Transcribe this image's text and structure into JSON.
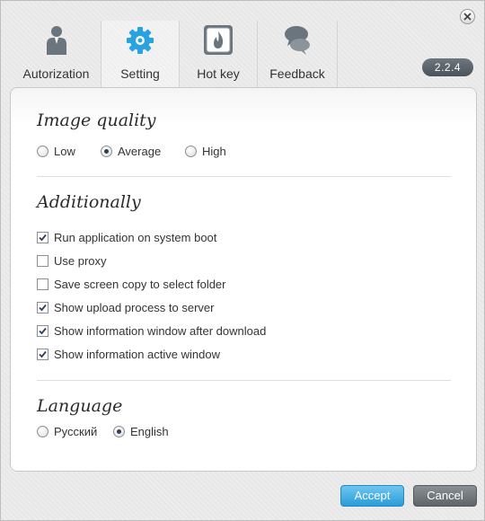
{
  "window": {
    "version": "2.2.4"
  },
  "tabs": [
    {
      "label": "Autorization",
      "icon": "user-icon"
    },
    {
      "label": "Setting",
      "icon": "gear-icon",
      "active": true
    },
    {
      "label": "Hot key",
      "icon": "flame-icon"
    },
    {
      "label": "Feedback",
      "icon": "chat-bubbles-icon"
    }
  ],
  "image_quality": {
    "title": "Image quality",
    "options": [
      {
        "label": "Low",
        "selected": false
      },
      {
        "label": "Average",
        "selected": true
      },
      {
        "label": "High",
        "selected": false
      }
    ]
  },
  "additionally": {
    "title": "Additionally",
    "options": [
      {
        "label": "Run application on system boot",
        "checked": true
      },
      {
        "label": "Use proxy",
        "checked": false
      },
      {
        "label": "Save screen copy to select folder",
        "checked": false
      },
      {
        "label": "Show upload process to server",
        "checked": true
      },
      {
        "label": "Show information window after download",
        "checked": true
      },
      {
        "label": "Show information active window",
        "checked": true
      }
    ]
  },
  "language": {
    "title": "Language",
    "options": [
      {
        "label": "Русский",
        "selected": false
      },
      {
        "label": "English",
        "selected": true
      }
    ]
  },
  "buttons": {
    "accept": "Accept",
    "cancel": "Cancel"
  },
  "colors": {
    "accent": "#2b9cd8",
    "gear_icon": "#29a3e0",
    "cancel_button": "#5f6469"
  }
}
